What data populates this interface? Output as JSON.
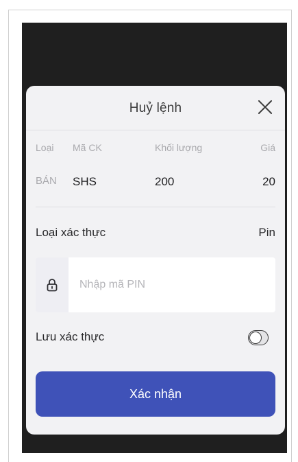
{
  "dialog": {
    "title": "Huỷ lệnh",
    "close_icon": "close-icon"
  },
  "order": {
    "headers": [
      "Loại",
      "Mã CK",
      "Khối lượng",
      "Giá"
    ],
    "values": [
      "BÁN",
      "SHS",
      "200",
      "20"
    ]
  },
  "auth": {
    "label": "Loại xác thực",
    "value": "Pin"
  },
  "pin": {
    "icon": "lock-icon",
    "placeholder": "Nhập mã PIN",
    "value": ""
  },
  "save_auth": {
    "label": "Lưu xác thực",
    "enabled": false
  },
  "confirm": {
    "label": "Xác nhận"
  },
  "colors": {
    "primary": "#3f52b8",
    "backdrop": "#1f1f1f",
    "dialog_bg": "#f2f2f4",
    "muted_text": "#a9a9ad"
  }
}
